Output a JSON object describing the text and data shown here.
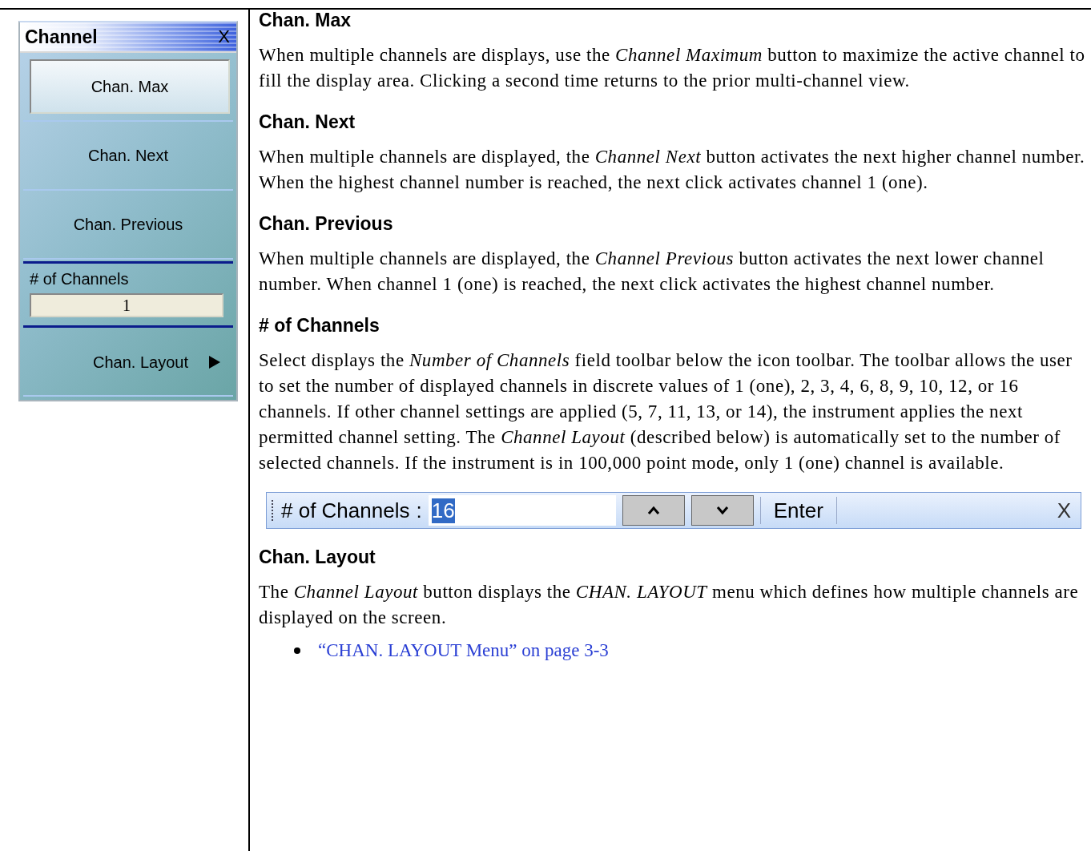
{
  "menu_panel": {
    "title": "Channel",
    "close": "X",
    "items": [
      {
        "kind": "button",
        "label": "Chan. Max",
        "highlighted": true
      },
      {
        "kind": "button",
        "label": "Chan. Next",
        "highlighted": false
      },
      {
        "kind": "button",
        "label": "Chan. Previous",
        "highlighted": false
      },
      {
        "kind": "field",
        "label": "# of Channels",
        "value": "1"
      },
      {
        "kind": "submenu",
        "label": "Chan. Layout"
      }
    ]
  },
  "sections": [
    {
      "heading": "Chan. Max",
      "paragraphs": [
        "When multiple channels are displays, use the *Channel Maximum* button to maximize the active channel to fill the display area. Clicking a second time returns to the prior multi-channel view."
      ]
    },
    {
      "heading": "Chan. Next",
      "paragraphs": [
        "When multiple channels are displayed, the *Channel Next* button activates the next higher channel number. When the highest channel number is reached, the next click activates channel 1 (one)."
      ]
    },
    {
      "heading": "Chan. Previous",
      "paragraphs": [
        "When multiple channels are displayed, the *Channel Previous* button activates the next lower channel number. When channel 1 (one) is reached, the next click activates the highest channel number."
      ]
    },
    {
      "heading": "# of Channels",
      "paragraphs": [
        "Select displays the *Number of Channels* field toolbar below the icon toolbar. The toolbar allows the user to set the number of displayed channels in discrete values of 1 (one), 2, 3, 4, 6, 8, 9, 10, 12, or 16 channels. If other channel settings are applied (5, 7, 11, 13, or 14), the instrument applies the next permitted channel setting. The *Channel Layout* (described below) is automatically set to the number of selected channels. If the instrument is in 100,000 point mode, only 1 (one) channel is available."
      ],
      "toolbar": {
        "label": "# of Channels",
        "separator": ":",
        "value": "16",
        "value_selected": true,
        "enter": "Enter",
        "close": "X"
      }
    },
    {
      "heading": "Chan. Layout",
      "paragraphs": [
        "The *Channel Layout* button displays the *CHAN. LAYOUT* menu which defines how multiple channels are displayed on the screen."
      ],
      "links": [
        "“CHAN. LAYOUT Menu” on page 3-3"
      ]
    }
  ]
}
